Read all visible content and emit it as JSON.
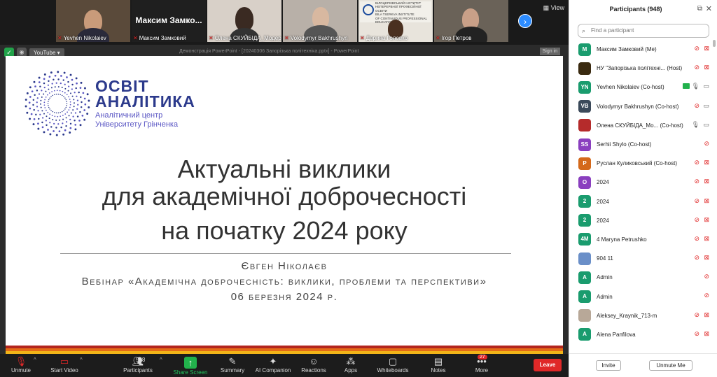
{
  "video_strip": {
    "tiles": [
      {
        "name": "Yevhen Nikolaiev",
        "muted": true
      },
      {
        "name": "Максим Замковий",
        "muted": true,
        "big_label": "Максим Замко..."
      },
      {
        "name": "Олена СКУЙБІДА_Модер...",
        "muted": true
      },
      {
        "name": "Volodymyr Bakhrushyn",
        "muted": true
      },
      {
        "name": "Дарина Головко",
        "muted": true
      },
      {
        "name": "Ігор Петров",
        "muted": true
      }
    ],
    "banner_lines": [
      "БІЛОЦЕРКІВСЬКИЙ ІНСТИТУТ",
      "НЕПЕРЕРВНОЇ ПРОФЕСІЙНОЇ ОСВІТИ",
      "BILA TSERKVA INSTITUTE",
      "OF CONTINUOUS PROFESSIONAL",
      "EDUCATION"
    ],
    "view_label": "View",
    "next_glyph": "›"
  },
  "share": {
    "youtube_label": "YouTube ▾",
    "window_title": "Демонстрація PowerPoint - [20240306 Запорізька політехніка.pptx] - PowerPoint",
    "signin_label": "Sign in",
    "slide": {
      "logo_line1": "ОСВІТ",
      "logo_line2": "АНАЛІТИКА",
      "logo_line3": "Аналітичний центр",
      "logo_line4": "Університету Грінченка",
      "title_lines": [
        "Актуальні виклики",
        "для академічної доброчесності",
        "на початку 2024 року"
      ],
      "author": "Євген Ніколаєв",
      "webinar": "Вебінар «Академічна доброчесність: виклики, проблеми та перспективи»",
      "date": "06 березня 2024 р."
    }
  },
  "toolbar": {
    "unmute": "Unmute",
    "start_video": "Start Video",
    "participants": "Participants",
    "participants_count": "948",
    "share_screen": "Share Screen",
    "summary": "Summary",
    "ai_companion": "AI Companion",
    "reactions": "Reactions",
    "apps": "Apps",
    "whiteboards": "Whiteboards",
    "notes": "Notes",
    "more": "More",
    "more_badge": "27",
    "leave": "Leave"
  },
  "panel": {
    "title": "Participants (948)",
    "search_placeholder": "Find a participant",
    "participants": [
      {
        "initials": "M",
        "color": "#1a9c6e",
        "name": "Максим Замковий (Me)",
        "mic": "muted",
        "cam": "off"
      },
      {
        "initials": "",
        "color": "#3a2a10",
        "name": "НУ \"Запорізька політехні... (Host)",
        "mic": "muted",
        "cam": "off",
        "image": true
      },
      {
        "initials": "YN",
        "color": "#1a9c6e",
        "name": "Yevhen Nikolaiev (Co-host)",
        "mic": "on",
        "cam": "on",
        "share": true
      },
      {
        "initials": "VB",
        "color": "#3b4a5a",
        "name": "Volodymyr Bakhrushyn (Co-host)",
        "mic": "muted",
        "cam": "on"
      },
      {
        "initials": "",
        "color": "#b52b2b",
        "name": "Олена СКУЙБІДА_Мо... (Co-host)",
        "mic": "on",
        "cam": "on",
        "image": true
      },
      {
        "initials": "SS",
        "color": "#8a3fbf",
        "name": "Serhii Shylo (Co-host)",
        "mic": "muted",
        "cam": ""
      },
      {
        "initials": "Р",
        "color": "#d4691b",
        "name": "Руслан Куликовський (Co-host)",
        "mic": "muted",
        "cam": "off"
      },
      {
        "initials": "О",
        "color": "#8a3fbf",
        "name": "2024",
        "mic": "muted",
        "cam": "off"
      },
      {
        "initials": "2",
        "color": "#1a9c6e",
        "name": "2024",
        "mic": "muted",
        "cam": "off"
      },
      {
        "initials": "2",
        "color": "#1a9c6e",
        "name": "2024",
        "mic": "muted",
        "cam": "off"
      },
      {
        "initials": "4M",
        "color": "#1a9c6e",
        "name": "4 Maryna Petrushko",
        "mic": "muted",
        "cam": "off"
      },
      {
        "initials": "",
        "color": "#6a8fc8",
        "name": "904 11",
        "mic": "muted",
        "cam": "off",
        "image": true
      },
      {
        "initials": "A",
        "color": "#1a9c6e",
        "name": "Admin",
        "mic": "muted",
        "cam": ""
      },
      {
        "initials": "A",
        "color": "#1a9c6e",
        "name": "Admin",
        "mic": "muted",
        "cam": ""
      },
      {
        "initials": "",
        "color": "#b8a898",
        "name": "Aleksey_Kraynik_713-m",
        "mic": "muted",
        "cam": "off",
        "image": true
      },
      {
        "initials": "A",
        "color": "#1a9c6e",
        "name": "Alena Panfilova",
        "mic": "muted",
        "cam": "off"
      }
    ],
    "invite": "Invite",
    "unmute_me": "Unmute Me"
  }
}
